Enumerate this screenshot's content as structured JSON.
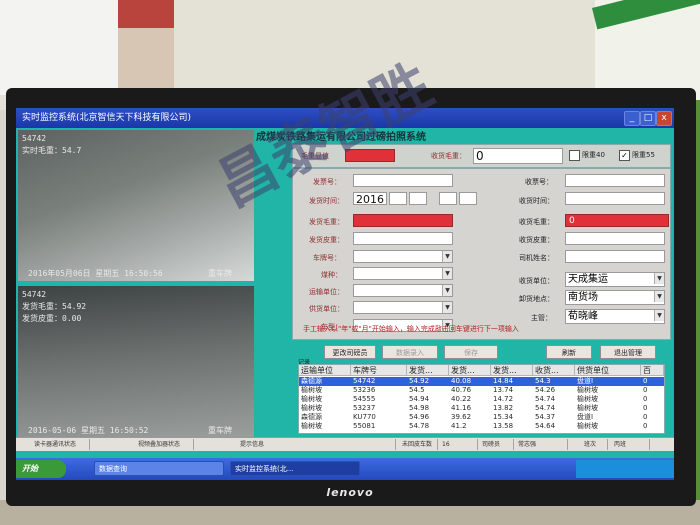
{
  "photo": {
    "monitor_brand": "lenovo"
  },
  "window": {
    "title": "实时监控系统(北京智信天下科技有限公司)",
    "app_title": "成煤炭铁路集运有限公司过磅拍照系统",
    "minimize": "_",
    "maximize": "□",
    "close": "x"
  },
  "cameras": {
    "cam1": {
      "id": "54742",
      "overlay": "实时毛重：54.7",
      "timestamp": "2016年05月06日  星期五  16:50:56",
      "label": "重车牌"
    },
    "cam2": {
      "id": "54742",
      "line1": "发货毛重：54.92",
      "line2": "发货皮重：0.00",
      "timestamp": "2016-05-06  星期五  16:50:52",
      "label": "重车牌"
    }
  },
  "top_panel": {
    "gross_weight_label": "毛重显值",
    "receive_gross_label": "收货毛重：",
    "receive_gross_value": "0",
    "check_40": "限重40",
    "check_55": "限重55",
    "check_55_checked": true
  },
  "form_left": {
    "ticket_no_label": "发票号：",
    "ship_time_label": "发货时间：",
    "ship_time_value": "2016",
    "gross_label": "发货毛重：",
    "tare_label": "发货皮重：",
    "plate_label": "车牌号：",
    "coal_label": "煤种：",
    "transport_label": "运输单位：",
    "supplier_label": "供货单位：",
    "car_type_label": "车型："
  },
  "form_right": {
    "ticket_no_label": "收票号：",
    "receive_time_label": "收货时间：",
    "receive_gross_label": "收货毛重：",
    "receive_gross_value": "0",
    "receive_tare_label": "收货皮重：",
    "driver_label": "司机姓名：",
    "receiver_label": "收货单位：",
    "receiver_value": "天成集运",
    "unload_label": "卸货地点：",
    "unload_value": "南货场",
    "manager_label": "主管：",
    "manager_value": "荀晓峰"
  },
  "note": "手工输入以\"年\"或\"月\"开始输入，输入完成敲击回车键进行下一项输入",
  "buttons": {
    "change_driver": "更改司磅员",
    "manual_entry": "数据录入",
    "save": "保存",
    "refresh": "刷新",
    "exit": "退出管理"
  },
  "table": {
    "tab_label": "记录",
    "columns": [
      "运输单位",
      "车牌号",
      "发货...",
      "发货...",
      "发货...",
      "收货...",
      "供货单位",
      "百"
    ],
    "rows": [
      [
        "森德源",
        "54742",
        "54.92",
        "40.08",
        "14.84",
        "54.3",
        "盘道I",
        "0"
      ],
      [
        "榆树坡",
        "53236",
        "54.5",
        "40.76",
        "13.74",
        "54.26",
        "榆树坡",
        "0"
      ],
      [
        "榆树坡",
        "54555",
        "54.94",
        "40.22",
        "14.72",
        "54.74",
        "榆树坡",
        "0"
      ],
      [
        "榆树坡",
        "53237",
        "54.98",
        "41.16",
        "13.82",
        "54.74",
        "榆树坡",
        "0"
      ],
      [
        "森德源",
        "KU770",
        "54.96",
        "39.62",
        "15.34",
        "54.37",
        "盘道I",
        "0"
      ],
      [
        "榆树坡",
        "55081",
        "54.78",
        "41.2",
        "13.58",
        "54.64",
        "榆树坡",
        "0"
      ]
    ],
    "selected_row": 0
  },
  "status_bar": {
    "c1": "读卡器通讯状态",
    "c2": "视频叠加器状态",
    "c3": "提示信息",
    "c4": "未回皮车数",
    "c5": "16",
    "c6": "司磅员",
    "c7": "常志强",
    "c8": "班次",
    "c9": "丙班"
  },
  "taskbar": {
    "start": "开始",
    "task1": "数据查询",
    "task2": "实时监控系统(北..."
  },
  "watermark": "昌泰智胜"
}
